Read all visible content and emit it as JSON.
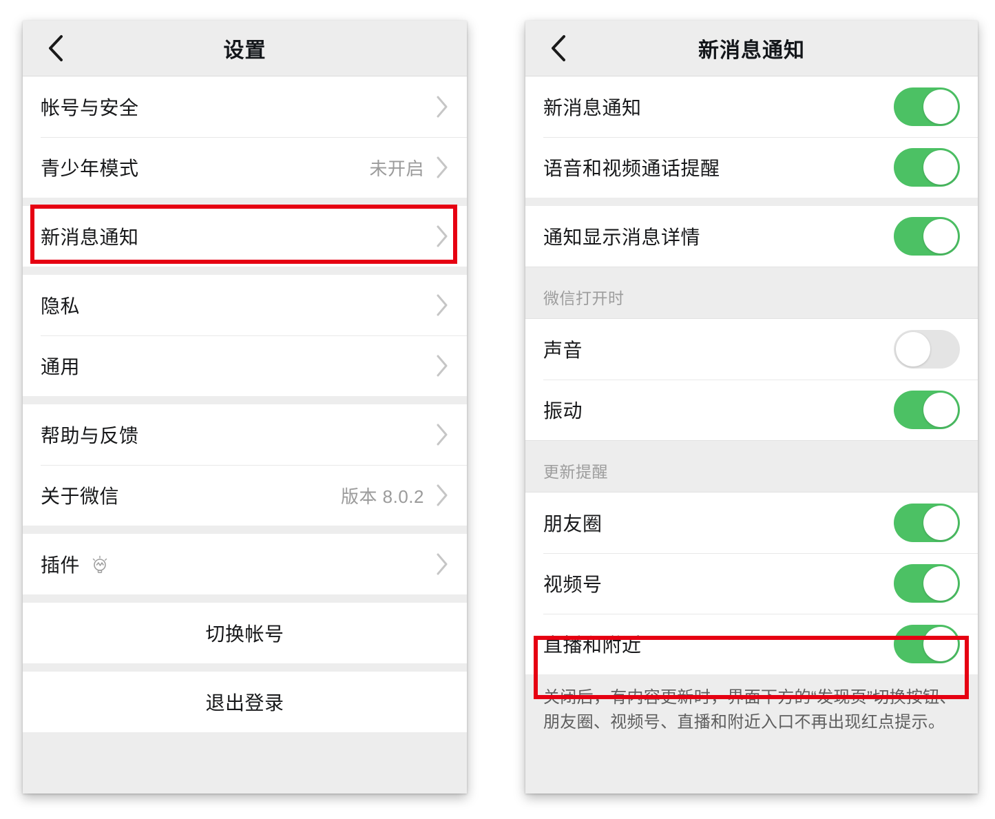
{
  "colors": {
    "accent_green": "#4cc164",
    "toggle_off": "#e4e4e4",
    "annotation_red": "#e60012",
    "page_bg": "#ededed",
    "card_bg": "#ffffff",
    "primary_text": "#17181a",
    "secondary_text": "#9b9b9b"
  },
  "left_screen": {
    "nav": {
      "back_icon": "chevron-left-icon",
      "title": "设置"
    },
    "groups": [
      {
        "rows": [
          {
            "label": "帐号与安全",
            "value": "",
            "accessory": "chevron-right-icon"
          },
          {
            "label": "青少年模式",
            "value": "未开启",
            "accessory": "chevron-right-icon"
          }
        ]
      },
      {
        "highlighted": true,
        "rows": [
          {
            "label": "新消息通知",
            "value": "",
            "accessory": "chevron-right-icon"
          }
        ]
      },
      {
        "rows": [
          {
            "label": "隐私",
            "value": "",
            "accessory": "chevron-right-icon"
          },
          {
            "label": "通用",
            "value": "",
            "accessory": "chevron-right-icon"
          }
        ]
      },
      {
        "rows": [
          {
            "label": "帮助与反馈",
            "value": "",
            "accessory": "chevron-right-icon"
          },
          {
            "label": "关于微信",
            "value": "版本 8.0.2",
            "accessory": "chevron-right-icon"
          }
        ]
      },
      {
        "rows": [
          {
            "label": "插件",
            "value": "",
            "accessory": "chevron-right-icon",
            "icon": "lightbulb-icon"
          }
        ]
      },
      {
        "rows": [
          {
            "label": "切换帐号",
            "centered": true
          }
        ]
      },
      {
        "rows": [
          {
            "label": "退出登录",
            "centered": true
          }
        ]
      }
    ]
  },
  "right_screen": {
    "nav": {
      "back_icon": "chevron-left-icon",
      "title": "新消息通知"
    },
    "groups": [
      {
        "rows": [
          {
            "label": "新消息通知",
            "toggle": "on"
          },
          {
            "label": "语音和视频通话提醒",
            "toggle": "on"
          }
        ]
      },
      {
        "rows": [
          {
            "label": "通知显示消息详情",
            "toggle": "on"
          }
        ]
      },
      {
        "section_header": "微信打开时",
        "rows": [
          {
            "label": "声音",
            "toggle": "off"
          },
          {
            "label": "振动",
            "toggle": "on"
          }
        ]
      },
      {
        "section_header": "更新提醒",
        "rows": [
          {
            "label": "朋友圈",
            "toggle": "on"
          },
          {
            "label": "视频号",
            "toggle": "on"
          },
          {
            "label": "直播和附近",
            "toggle": "on",
            "highlighted": true
          }
        ]
      }
    ],
    "footnote": "关闭后，有内容更新时，界面下方的“发现页”切换按钮、朋友圈、视频号、直播和附近入口不再出现红点提示。"
  }
}
